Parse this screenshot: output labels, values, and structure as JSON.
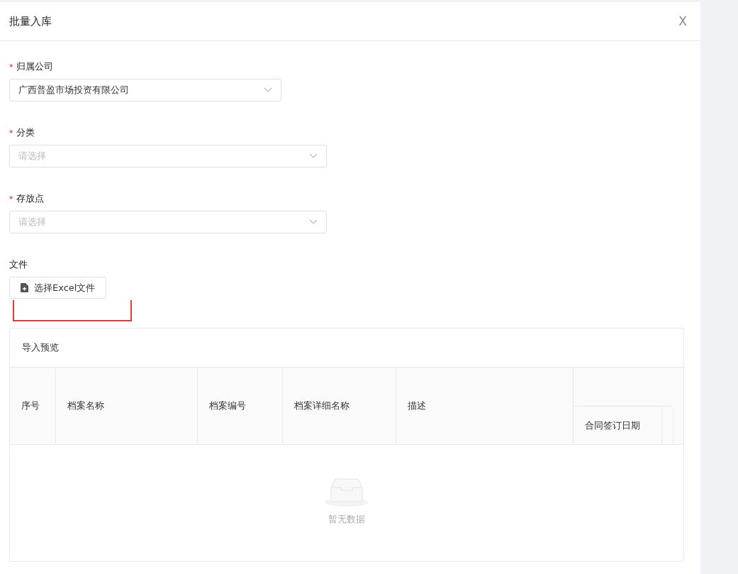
{
  "dialog": {
    "title": "批量入库",
    "close_icon": "X"
  },
  "fields": [
    {
      "label": "归属公司",
      "required_mark": "*",
      "value": "广西普盈市场投资有限公司",
      "kind": "narrow"
    },
    {
      "label": "分类",
      "required_mark": "*",
      "placeholder": "请选择",
      "kind": "wide"
    },
    {
      "label": "存放点",
      "required_mark": "*",
      "placeholder": "请选择",
      "kind": "wide"
    }
  ],
  "file": {
    "label": "文件",
    "button": "选择Excel文件"
  },
  "preview": {
    "title": "导入预览",
    "columns": [
      {
        "label": "序号"
      },
      {
        "label": "档案名称"
      },
      {
        "label": "档案编号"
      },
      {
        "label": "档案详细名称"
      },
      {
        "label": "描述"
      }
    ],
    "group_columns": [
      {
        "label": "合同签订日期"
      }
    ],
    "empty_text": "暂无数据"
  }
}
